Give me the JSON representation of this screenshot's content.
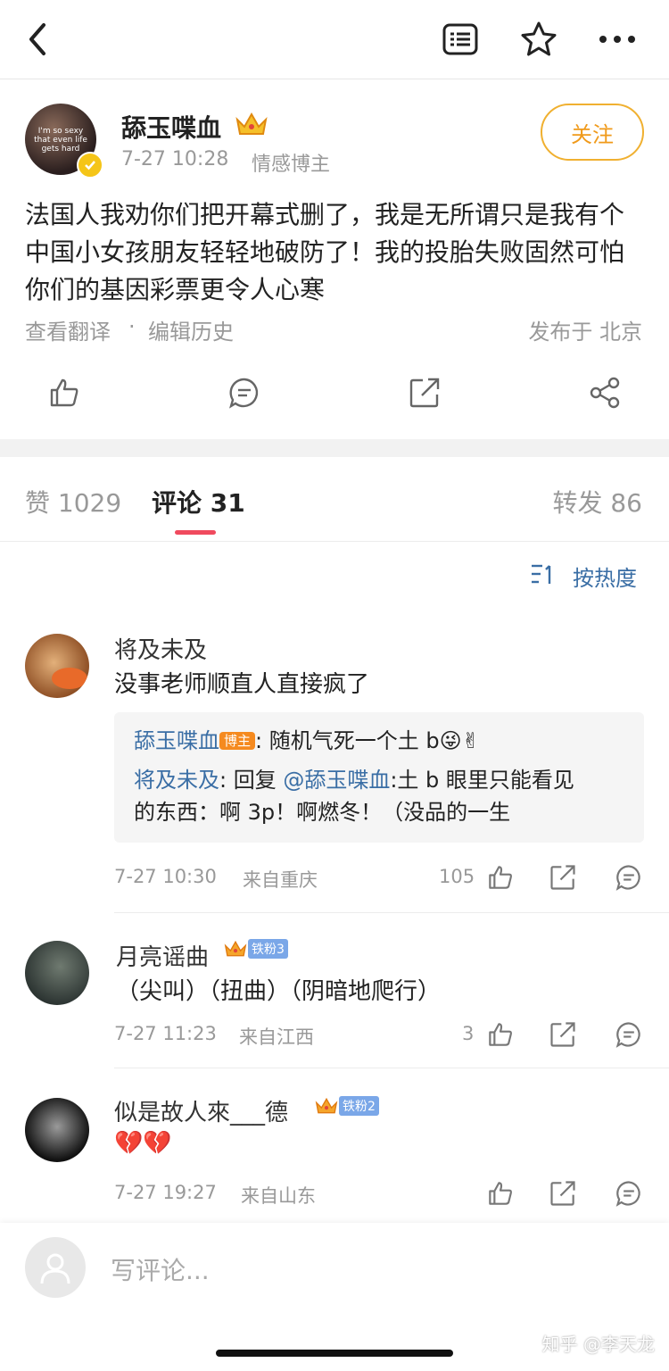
{
  "topbar": {
    "back_icon": "chevron-left-icon",
    "icons": [
      "reader-icon",
      "star-icon",
      "more-icon"
    ]
  },
  "post": {
    "author": "舔玉喋血",
    "time": "7-27 10:28",
    "category": "情感博主",
    "follow_label": "关注",
    "text": "法国人我劝你们把开幕式删了，我是无所谓只是我有个中国小女孩朋友轻轻地破防了！我的投胎失败固然可怕你们的基因彩票更令人心寒",
    "translate_label": "查看翻译",
    "dot": "·",
    "edit_history_label": "编辑历史",
    "location": "发布于 北京",
    "avatar_text": "I'm so sexy that even life gets hard"
  },
  "tabs": {
    "likes": "赞 1029",
    "comments": "评论 31",
    "reposts": "转发 86"
  },
  "sort_label": "按热度",
  "comments": [
    {
      "name": "将及未及",
      "text": "没事老师顺直人直接疯了",
      "replies": {
        "line1_name": "舔玉喋血",
        "line1_badge": "博主",
        "line1_text": ": 随机气死一个土 b😜✌",
        "line2_name": "将及未及",
        "line2_mid": ": 回复 ",
        "line2_at": "@舔玉喋血",
        "line2_text": ":土 b 眼里只能看见",
        "line3_text": "的东西：啊 3p！啊燃冬！（没品的一生"
      },
      "time": "7-27 10:30",
      "from": "来自重庆",
      "likes": "105"
    },
    {
      "name": "月亮谣曲",
      "badge": "铁粉3",
      "text": "（尖叫）（扭曲）（阴暗地爬行）",
      "time": "7-27 11:23",
      "from": "来自江西",
      "likes": "3"
    },
    {
      "name": "似是故人來___德",
      "badge": "铁粉2",
      "text": "💔💔",
      "time": "7-27 19:27",
      "from": "来自山东",
      "likes": ""
    }
  ],
  "bottom": {
    "placeholder": "写评论...",
    "watermark": "知乎 @李天龙"
  },
  "colors": {
    "accent_tab": "#f04a5e",
    "link_blue": "#3a6ea5",
    "follow_orange": "#f0b030"
  }
}
